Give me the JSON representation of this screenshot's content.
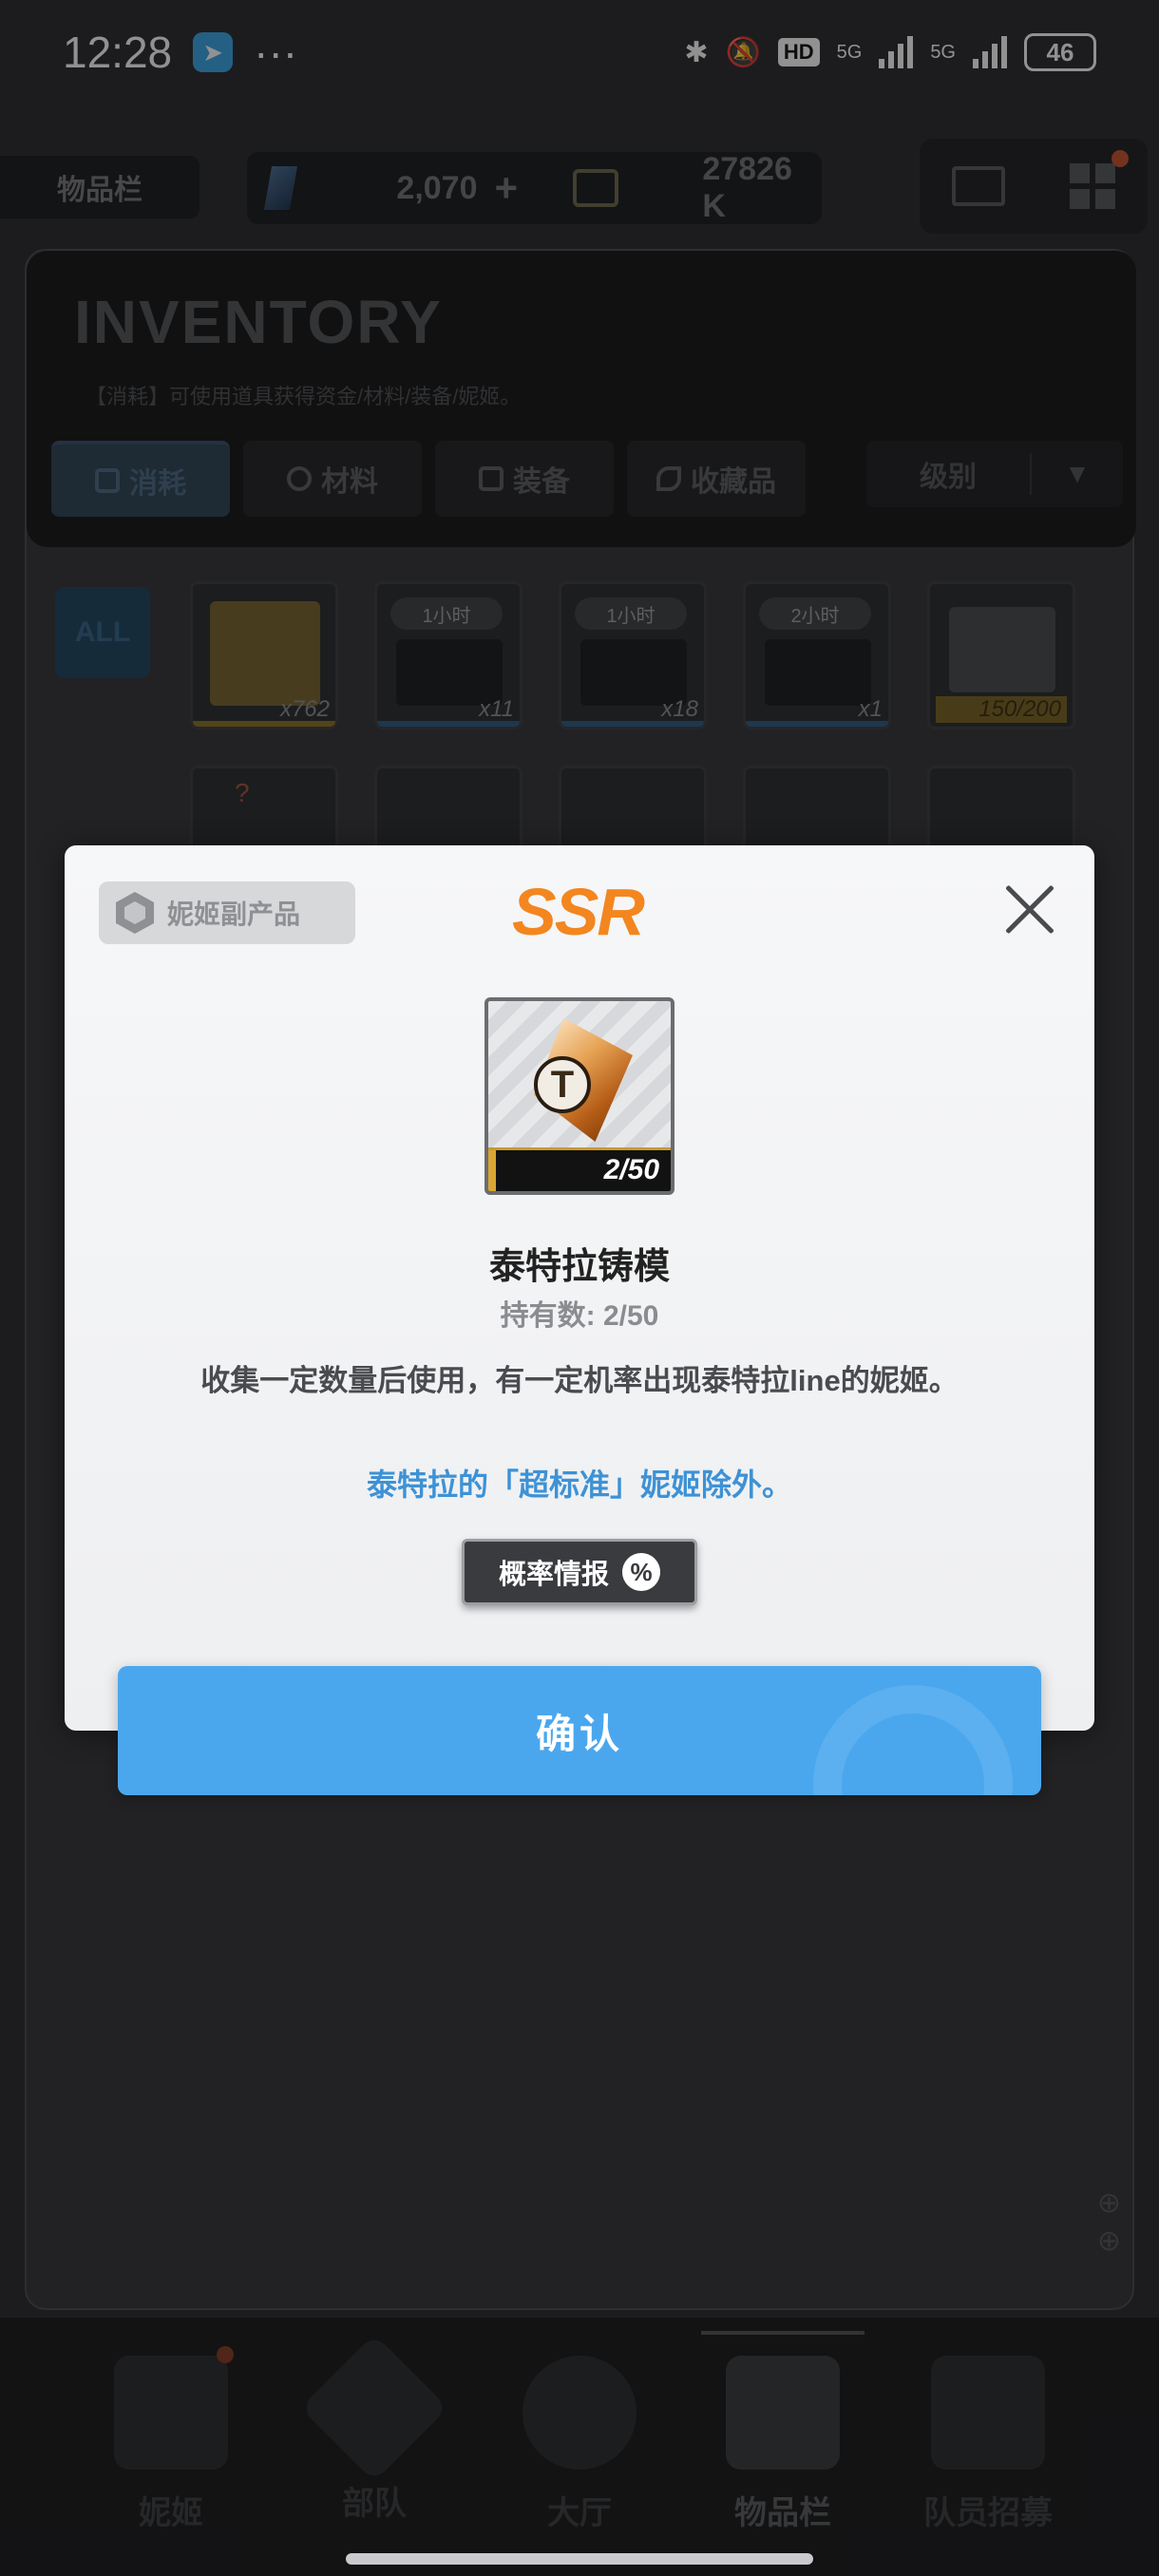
{
  "status_bar": {
    "time": "12:28",
    "more": "···",
    "hd_label": "HD",
    "net1": "5G",
    "net2": "5G",
    "battery": "46"
  },
  "top_bar": {
    "tab_label": "物品栏",
    "gems": "2,070",
    "gems_plus": "+",
    "credits": "27826 K"
  },
  "inventory": {
    "title": "INVENTORY",
    "subtitle": "【消耗】可使用道具获得资金/材料/装备/妮姬。",
    "filters": [
      {
        "label": "消耗"
      },
      {
        "label": "材料"
      },
      {
        "label": "装备"
      },
      {
        "label": "收藏品"
      }
    ],
    "sort_label": "级别",
    "sort_arrow": "▼",
    "all_label": "ALL",
    "items": [
      {
        "count": "x762"
      },
      {
        "time": "1小时",
        "count": "x11"
      },
      {
        "time": "1小时",
        "count": "x18"
      },
      {
        "time": "2小时",
        "count": "x1"
      },
      {
        "count": "150/200"
      }
    ],
    "second_row_badge": "?"
  },
  "modal": {
    "tag": "妮姬副产品",
    "rarity": "SSR",
    "item_letter": "T",
    "progress_text": "2/50",
    "progress_fraction": 0.04,
    "item_name": "泰特拉铸模",
    "hold_count": "持有数: 2/50",
    "description": "收集一定数量后使用，有一定机率出现泰特拉line的妮姬。",
    "note": "泰特拉的「超标准」妮姬除外。",
    "prob_button": "概率情报",
    "prob_icon": "%",
    "confirm": "确认"
  },
  "bottom_nav": [
    {
      "label": "妮姬"
    },
    {
      "label": "部队"
    },
    {
      "label": "大厅"
    },
    {
      "label": "物品栏"
    },
    {
      "label": "队员招募"
    }
  ],
  "colors": {
    "accent_blue": "#4aa7ee",
    "rarity_orange": "#f3861f",
    "note_blue": "#3d92d6"
  }
}
